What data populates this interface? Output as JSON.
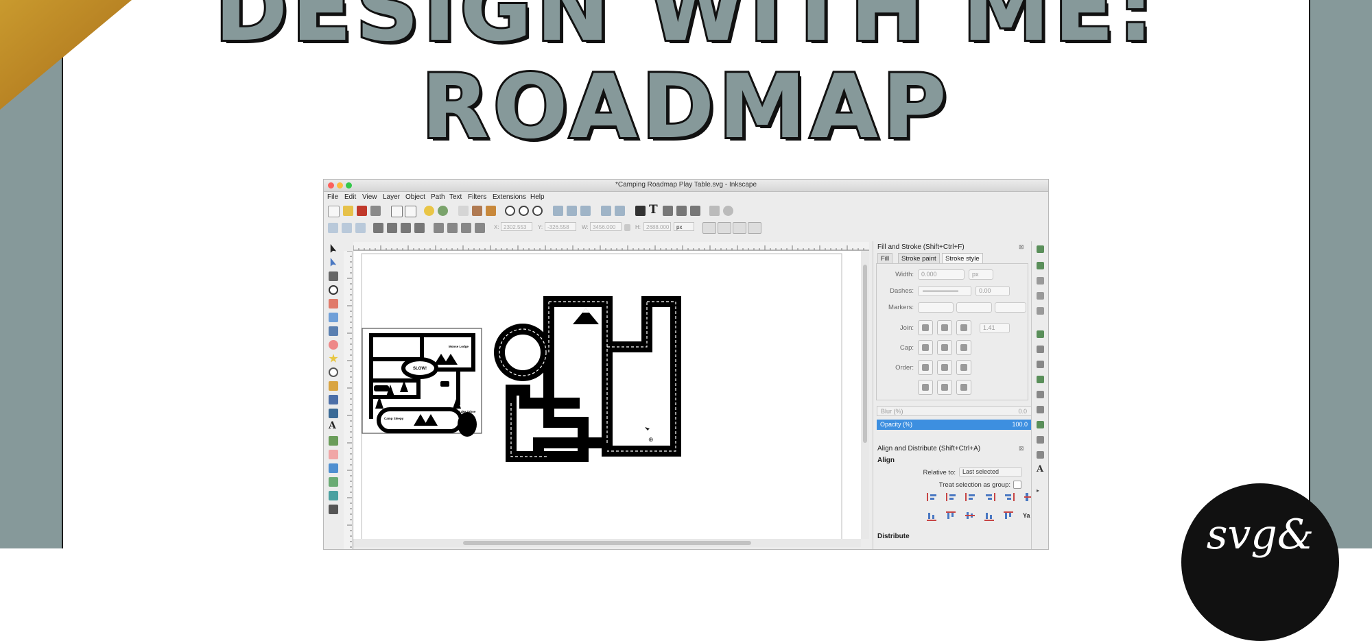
{
  "poster": {
    "title_line1": "DESIGN WITH ME:",
    "title_line2": "ROADMAP",
    "badge_text": "svg&"
  },
  "window": {
    "title": "*Camping Roadmap Play Table.svg - Inkscape",
    "menu": [
      "File",
      "Edit",
      "View",
      "Layer",
      "Object",
      "Path",
      "Text",
      "Filters",
      "Extensions",
      "Help"
    ]
  },
  "controls": {
    "x_label": "X:",
    "x_value": "2302.553",
    "y_label": "Y:",
    "y_value": "-326.558",
    "w_label": "W:",
    "w_value": "3456.000",
    "h_label": "H:",
    "h_value": "2688.000",
    "unit": "px"
  },
  "fill_stroke": {
    "title": "Fill and Stroke (Shift+Ctrl+F)",
    "tabs": [
      "Fill",
      "Stroke paint",
      "Stroke style"
    ],
    "width_label": "Width:",
    "width_value": "0.000",
    "width_unit": "px",
    "dashes_label": "Dashes:",
    "dashes_value": "0.00",
    "markers_label": "Markers:",
    "join_label": "Join:",
    "join_value": "1.41",
    "cap_label": "Cap:",
    "order_label": "Order:",
    "blur_label": "Blur (%)",
    "blur_value": "0.0",
    "opacity_label": "Opacity (%)",
    "opacity_value": "100.0"
  },
  "align": {
    "title": "Align and Distribute (Shift+Ctrl+A)",
    "section": "Align",
    "relative_label": "Relative to:",
    "relative_value": "Last selected",
    "group_label": "Treat selection as group:",
    "distribute": "Distribute"
  },
  "map_thumb": {
    "slow": "SLOW!",
    "moose": "Moose Lodge",
    "camp": "Camp Sleepy",
    "lake": "Lake Tahoe"
  },
  "colors": {
    "accent": "#86999a",
    "opacity_bar": "#3d8fe0",
    "road": "#000000"
  }
}
